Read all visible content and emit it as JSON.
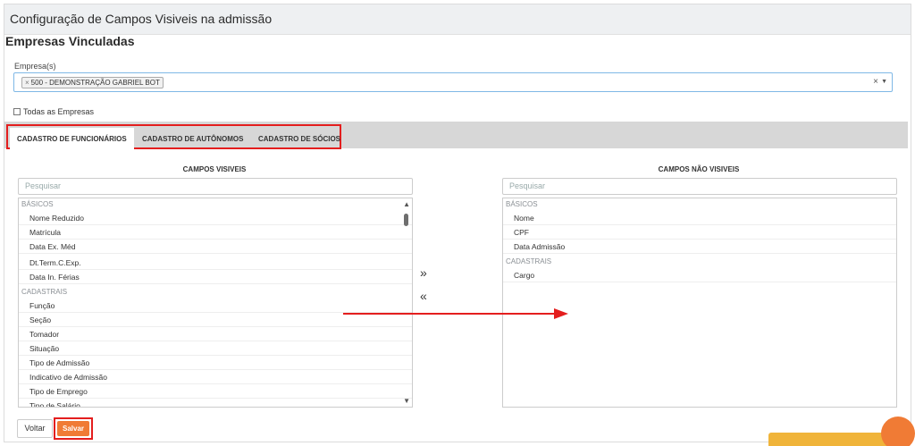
{
  "page": {
    "title": "Configuração de Campos Visiveis na admissão",
    "section_title": "Empresas Vinculadas"
  },
  "empresa": {
    "label": "Empresa(s)",
    "selected_chip": "500 - DEMONSTRAÇÃO GABRIEL BOT",
    "chip_remove": "×",
    "clear": "×",
    "dropdown_arrow": "▼",
    "all_companies_label": "Todas as Empresas"
  },
  "tabs": [
    {
      "label": "CADASTRO DE FUNCIONÁRIOS",
      "active": true
    },
    {
      "label": "CADASTRO DE AUTÔNOMOS",
      "active": false
    },
    {
      "label": "CADASTRO DE SÓCIOS",
      "active": false
    }
  ],
  "visible_fields": {
    "title": "CAMPOS VISIVEIS",
    "search_placeholder": "Pesquisar",
    "groups": [
      {
        "name": "BÁSICOS",
        "items": [
          "Nome Reduzido",
          "Matrícula",
          "Data Ex. Méd",
          "Dt.Term.C.Exp.",
          "Data In. Férias"
        ]
      },
      {
        "name": "CADASTRAIS",
        "items": [
          "Função",
          "Seção",
          "Tomador",
          "Situação",
          "Tipo de Admissão",
          "Indicativo de Admissão",
          "Tipo de Emprego",
          "Tipo de Salário"
        ]
      }
    ]
  },
  "hidden_fields": {
    "title": "CAMPOS NÃO VISIVEIS",
    "search_placeholder": "Pesquisar",
    "groups": [
      {
        "name": "BÁSICOS",
        "items": [
          "Nome",
          "CPF",
          "Data Admissão"
        ]
      },
      {
        "name": "CADASTRAIS",
        "items": [
          "Cargo"
        ]
      }
    ]
  },
  "move": {
    "to_hidden": "»",
    "to_visible": "«"
  },
  "scroll": {
    "up": "▲",
    "down": "▼"
  },
  "footer": {
    "back_label": "Voltar",
    "save_label": "Salvar"
  },
  "colors": {
    "accent": "#f07b35",
    "highlight": "#e41e1e"
  }
}
